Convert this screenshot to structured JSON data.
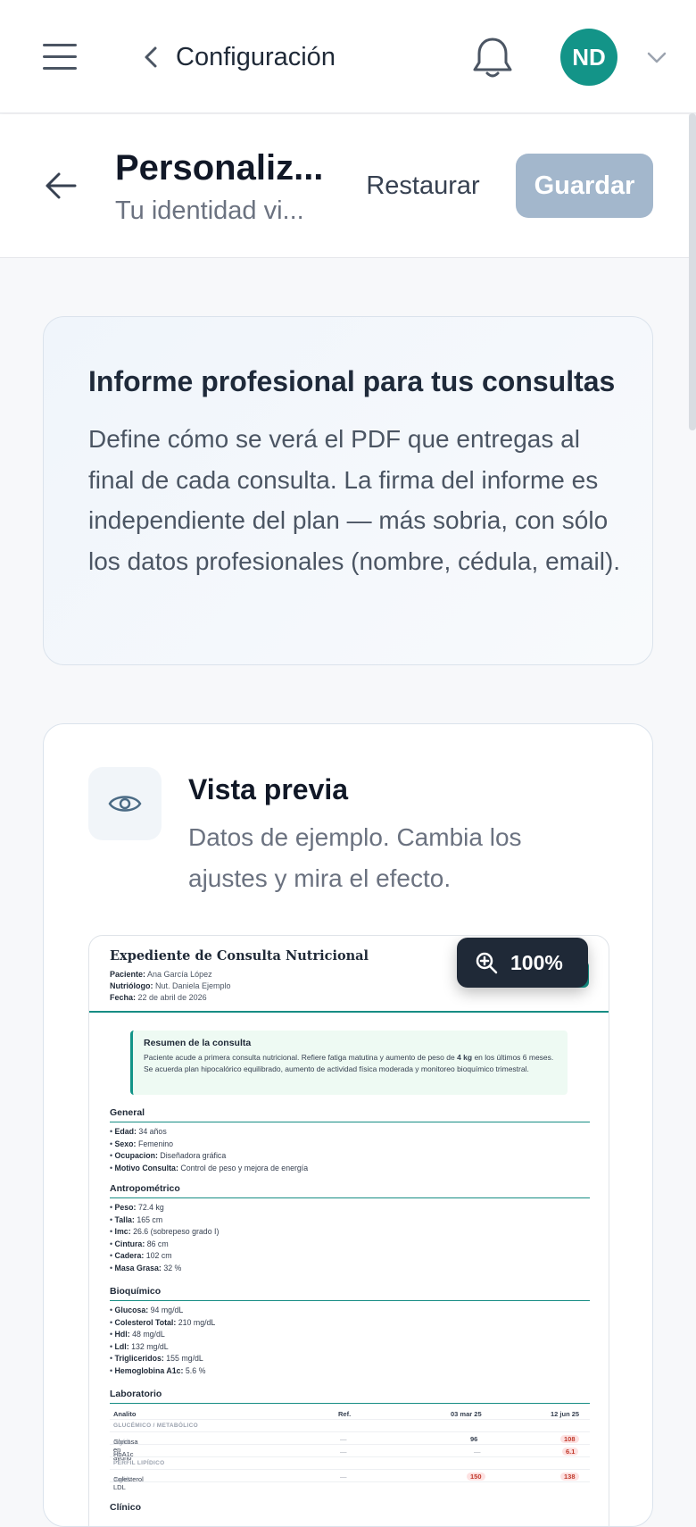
{
  "topbar": {
    "title": "Configuración",
    "avatar_initials": "ND",
    "icons": {
      "menu": "hamburger-icon",
      "back": "chevron-left-icon",
      "notifications": "bell-icon",
      "account_menu": "chevron-down-icon"
    }
  },
  "header": {
    "title": "Personaliz...",
    "subtitle": "Tu identidad vi...",
    "restore_label": "Restaurar",
    "save_label": "Guardar"
  },
  "info_card": {
    "title": "Informe profesional para tus consultas",
    "text": "Define cómo se verá el PDF que entregas al final de cada consulta. La firma del informe es independiente del plan — más sobria, con sólo los datos profesionales (nombre, cédula, email)."
  },
  "preview": {
    "title": "Vista previa",
    "subtitle": "Datos de ejemplo. Cambia los ajustes y mira el efecto.",
    "zoom_label": "100%",
    "document": {
      "title": "Expediente de Consulta Nutricional",
      "patient_label": "Paciente:",
      "patient": "Ana García López",
      "nutri_label": "Nutriólogo:",
      "nutri": "Nut. Daniela Ejemplo",
      "date_label": "Fecha:",
      "date": "22 de abril de 2026",
      "summary_title": "Resumen de la consulta",
      "summary_pre": "Paciente acude a primera consulta nutricional. Refiere fatiga matutina y aumento de peso de ",
      "summary_bold": "4 kg",
      "summary_post": " en los últimos 6 meses. Se acuerda plan hipocalórico equilibrado, aumento de actividad física moderada y monitoreo bioquímico trimestral.",
      "sections": {
        "general": {
          "title": "General",
          "items": [
            {
              "k": "Edad:",
              "v": "34 años"
            },
            {
              "k": "Sexo:",
              "v": "Femenino"
            },
            {
              "k": "Ocupacion:",
              "v": "Diseñadora gráfica"
            },
            {
              "k": "Motivo Consulta:",
              "v": "Control de peso y mejora de energía"
            }
          ]
        },
        "antropo": {
          "title": "Antropométrico",
          "items": [
            {
              "k": "Peso:",
              "v": "72.4 kg"
            },
            {
              "k": "Talla:",
              "v": "165 cm"
            },
            {
              "k": "Imc:",
              "v": "26.6 (sobrepeso grado I)"
            },
            {
              "k": "Cintura:",
              "v": "86 cm"
            },
            {
              "k": "Cadera:",
              "v": "102 cm"
            },
            {
              "k": "Masa Grasa:",
              "v": "32 %"
            }
          ]
        },
        "bioq": {
          "title": "Bioquímico",
          "items": [
            {
              "k": "Glucosa:",
              "v": "94 mg/dL"
            },
            {
              "k": "Colesterol Total:",
              "v": "210 mg/dL"
            },
            {
              "k": "Hdl:",
              "v": "48 mg/dL"
            },
            {
              "k": "Ldl:",
              "v": "132 mg/dL"
            },
            {
              "k": "Trigliceridos:",
              "v": "155 mg/dL"
            },
            {
              "k": "Hemoglobina A1c:",
              "v": "5.6 %"
            }
          ]
        },
        "lab": {
          "title": "Laboratorio",
          "headers": {
            "analito": "Analito",
            "ref": "Ref.",
            "d1": "03 mar 25",
            "d2": "12 jun 25"
          },
          "cat1": "GLUCÉMICO / METABÓLICO",
          "row1": {
            "name": "Glucosa en ayuno",
            "unit": "mg/dL",
            "ref": "—",
            "d1": "96",
            "d2": "108"
          },
          "row2": {
            "name": "HbA1c",
            "unit": "%",
            "ref": "—",
            "d1": "—",
            "d2": "6.1"
          },
          "cat2": "PERFIL LIPÍDICO",
          "row3": {
            "name": "Colesterol LDL",
            "unit": "mg/dL",
            "ref": "—",
            "d1": "150",
            "d2": "138"
          }
        },
        "clinico": {
          "title": "Clínico"
        }
      }
    }
  }
}
